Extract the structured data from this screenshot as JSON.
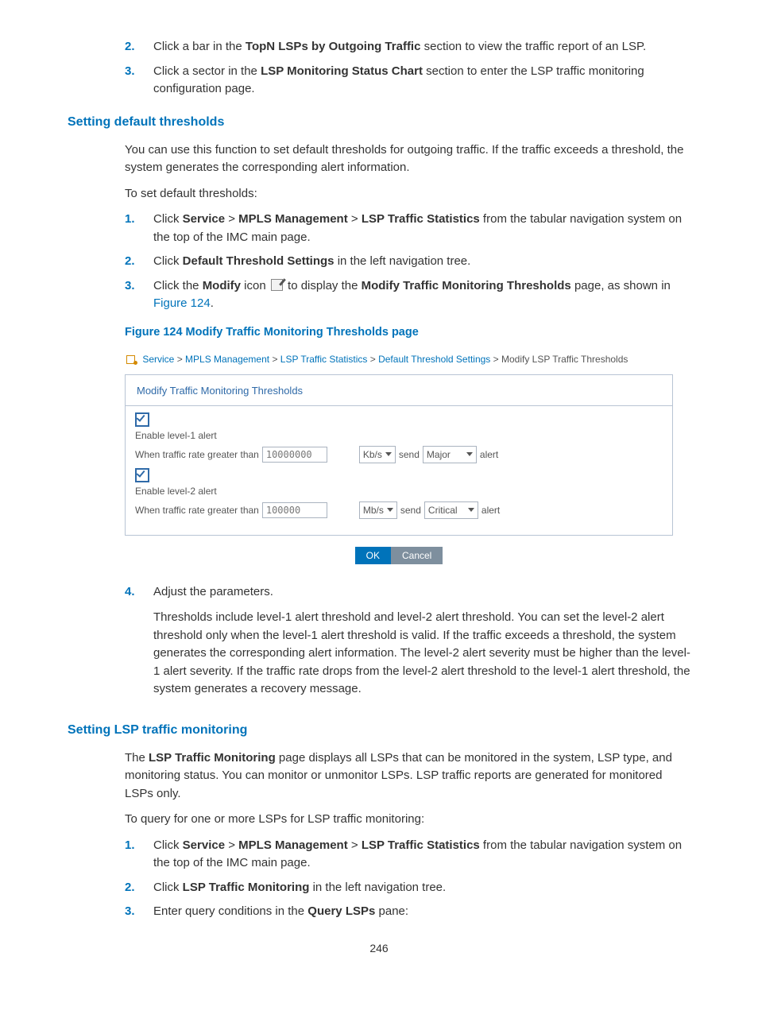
{
  "list_top": {
    "item2": {
      "num": "2.",
      "pre": "Click a bar in the ",
      "bold": "TopN LSPs by Outgoing Traffic",
      "post": " section to view the traffic report of an LSP."
    },
    "item3": {
      "num": "3.",
      "pre": "Click a sector in the ",
      "bold": "LSP Monitoring Status Chart",
      "post": " section to enter the LSP traffic monitoring configuration page."
    }
  },
  "sec1": {
    "heading": "Setting default thresholds",
    "p1": "You can use this function to set default thresholds for outgoing traffic. If the traffic exceeds a threshold, the system generates the corresponding alert information.",
    "p2": "To set default thresholds:",
    "l1": {
      "num": "1.",
      "pre": "Click ",
      "b1": "Service",
      "gt1": " > ",
      "b2": "MPLS Management",
      "gt2": " > ",
      "b3": "LSP Traffic Statistics",
      "post": " from the tabular navigation system on the top of the IMC main page."
    },
    "l2": {
      "num": "2.",
      "pre": "Click ",
      "b1": "Default Threshold Settings",
      "post": " in the left navigation tree."
    },
    "l3": {
      "num": "3.",
      "pre": "Click the ",
      "b1": "Modify",
      "mid": " icon ",
      "mid2": " to display the ",
      "b2": "Modify Traffic Monitoring Thresholds",
      "post": " page, as shown in ",
      "link": "Figure 124",
      "post2": "."
    },
    "l4": {
      "num": "4.",
      "text": "Adjust the parameters.",
      "sub": "Thresholds include level-1 alert threshold and level-2 alert threshold. You can set the level-2 alert threshold only when the level-1 alert threshold is valid. If the traffic exceeds a threshold, the system generates the corresponding alert information. The level-2 alert severity must be higher than the level-1 alert severity. If the traffic rate drops from the level-2 alert threshold to the level-1 alert threshold, the system generates a recovery message."
    }
  },
  "figure": {
    "caption": "Figure 124 Modify Traffic Monitoring Thresholds page",
    "bc": {
      "a1": "Service",
      "a2": "MPLS Management",
      "a3": "LSP Traffic Statistics",
      "a4": "Default Threshold Settings",
      "cur": "Modify LSP Traffic Thresholds",
      "sep": " > "
    },
    "panel_title": "Modify Traffic Monitoring Thresholds",
    "lvl1": {
      "label": "Enable level-1 alert",
      "when": "When traffic rate greater than",
      "value": "10000000",
      "unit": "Kb/s",
      "send": "send",
      "sev": "Major",
      "alert": "alert"
    },
    "lvl2": {
      "label": "Enable level-2 alert",
      "when": "When traffic rate greater than",
      "value": "100000",
      "unit": "Mb/s",
      "send": "send",
      "sev": "Critical",
      "alert": "alert"
    },
    "ok": "OK",
    "cancel": "Cancel"
  },
  "sec2": {
    "heading": "Setting LSP traffic monitoring",
    "p1_pre": "The ",
    "p1_bold": "LSP Traffic Monitoring",
    "p1_post": " page displays all LSPs that can be monitored in the system, LSP type, and monitoring status. You can monitor or unmonitor LSPs. LSP traffic reports are generated for monitored LSPs only.",
    "p2": "To query for one or more LSPs for LSP traffic monitoring:",
    "l1": {
      "num": "1.",
      "pre": "Click ",
      "b1": "Service",
      "gt1": " > ",
      "b2": "MPLS Management",
      "gt2": " > ",
      "b3": "LSP Traffic Statistics",
      "post": " from the tabular navigation system on the top of the IMC main page."
    },
    "l2": {
      "num": "2.",
      "pre": "Click ",
      "b1": "LSP Traffic Monitoring",
      "post": " in the left navigation tree."
    },
    "l3": {
      "num": "3.",
      "pre": "Enter query conditions in the ",
      "b1": "Query LSPs",
      "post": " pane:"
    }
  },
  "page_number": "246"
}
